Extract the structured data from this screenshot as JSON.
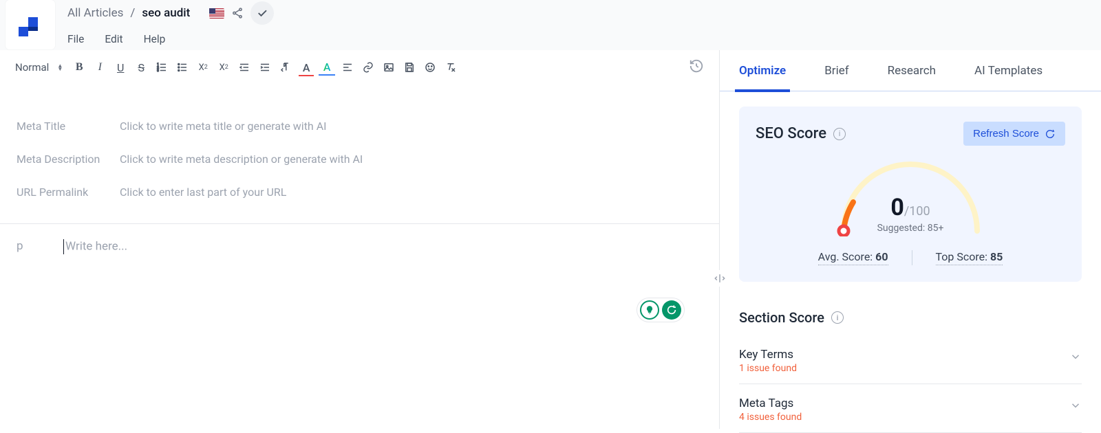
{
  "breadcrumb": {
    "all": "All Articles",
    "sep": "/",
    "current": "seo audit"
  },
  "menu": {
    "file": "File",
    "edit": "Edit",
    "help": "Help"
  },
  "toolbar": {
    "format": "Normal"
  },
  "meta": {
    "title_label": "Meta Title",
    "title_placeholder": "Click to write meta title or generate with AI",
    "desc_label": "Meta Description",
    "desc_placeholder": "Click to write meta description or generate with AI",
    "url_label": "URL Permalink",
    "url_placeholder": "Click to enter last part of your URL"
  },
  "editor": {
    "p_marker": "p",
    "placeholder": "Write here..."
  },
  "tabs": {
    "optimize": "Optimize",
    "brief": "Brief",
    "research": "Research",
    "ai_templates": "AI Templates"
  },
  "seo": {
    "title": "SEO Score",
    "refresh": "Refresh Score",
    "value": "0",
    "denom": "/100",
    "suggested": "Suggested: 85+",
    "avg_label": "Avg. Score: ",
    "avg_value": "60",
    "top_label": "Top Score: ",
    "top_value": "85"
  },
  "section_score": {
    "title": "Section Score"
  },
  "sections": {
    "key_terms": {
      "name": "Key Terms",
      "issues": "1 issue found"
    },
    "meta_tags": {
      "name": "Meta Tags",
      "issues": "4 issues found"
    }
  }
}
